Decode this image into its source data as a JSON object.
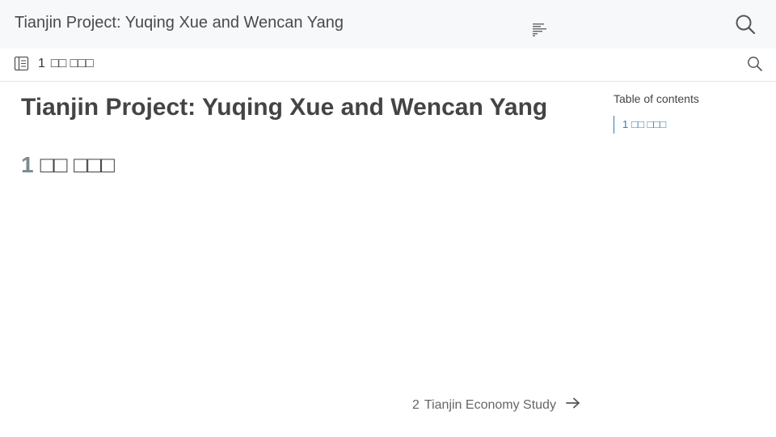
{
  "header": {
    "title": "Tianjin Project: Yuqing Xue and Wencan Yang",
    "menu_icon": "text-lines-icon",
    "search_icon": "search-icon"
  },
  "subbar": {
    "sidebar_icon": "book-icon",
    "chapter_number": "1",
    "chapter_title": "□□ □□□",
    "search_icon": "search-icon"
  },
  "main": {
    "page_title": "Tianjin Project: Yuqing Xue and Wencan Yang",
    "section_number": "1",
    "section_title": "□□ □□□"
  },
  "toc": {
    "title": "Table of contents",
    "items": [
      {
        "number": "1",
        "label": "□□ □□□"
      }
    ]
  },
  "pagination": {
    "next_number": "2",
    "next_label": "Tianjin Economy Study",
    "next_icon": "arrow-right-icon"
  },
  "colors": {
    "topbar_bg": "#f7f8fa",
    "link": "#2c7fb8",
    "text": "#444444",
    "section_number": "#7a8a93"
  }
}
